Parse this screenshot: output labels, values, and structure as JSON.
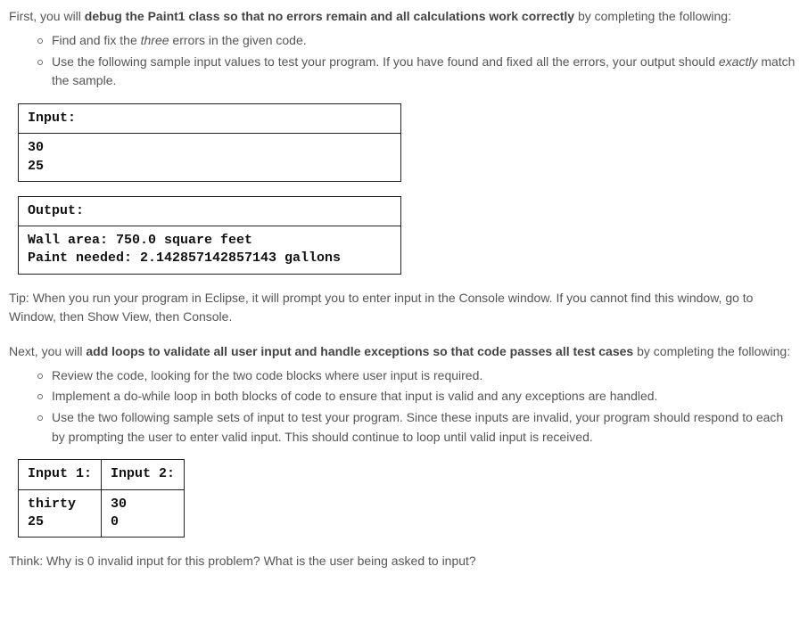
{
  "intro": {
    "prefix": "First, you will ",
    "bold": "debug the Paint1 class so that no errors remain and all calculations work correctly",
    "suffix": " by completing the following:"
  },
  "bullets1": {
    "b0_pre": "Find and fix the ",
    "b0_italic": "three",
    "b0_post": " errors in the given code.",
    "b1_pre": "Use the following sample input values to test your program. If you have found and fixed all the errors, your output should ",
    "b1_italic": "exactly",
    "b1_post": " match the sample."
  },
  "table1": {
    "input_header": "Input:",
    "input_body": "30\n25",
    "output_header": "Output:",
    "output_body": "Wall area: 750.0 square feet\nPaint needed: 2.142857142857143 gallons"
  },
  "tip": "Tip: When you run your program in Eclipse, it will prompt you to enter input in the Console window. If you cannot find this window, go to Window, then Show View, then Console.",
  "next": {
    "prefix": "Next, you will ",
    "bold": "add loops to validate all user input and handle exceptions so that code passes all test cases",
    "suffix": " by completing the following:"
  },
  "bullets2": {
    "b0": "Review the code, looking for the two code blocks where user input is required.",
    "b1": "Implement a do-while loop in both blocks of code to ensure that input is valid and any exceptions are handled.",
    "b2": "Use the two following sample sets of input to test your program. Since these inputs are invalid, your program should respond to each by prompting the user to enter valid input. This should continue to loop until valid input is received."
  },
  "table2": {
    "h1": "Input 1:",
    "h2": "Input 2:",
    "c1": "thirty\n25",
    "c2": "30\n0"
  },
  "think": "Think: Why is 0 invalid input for this problem? What is the user being asked to input?"
}
